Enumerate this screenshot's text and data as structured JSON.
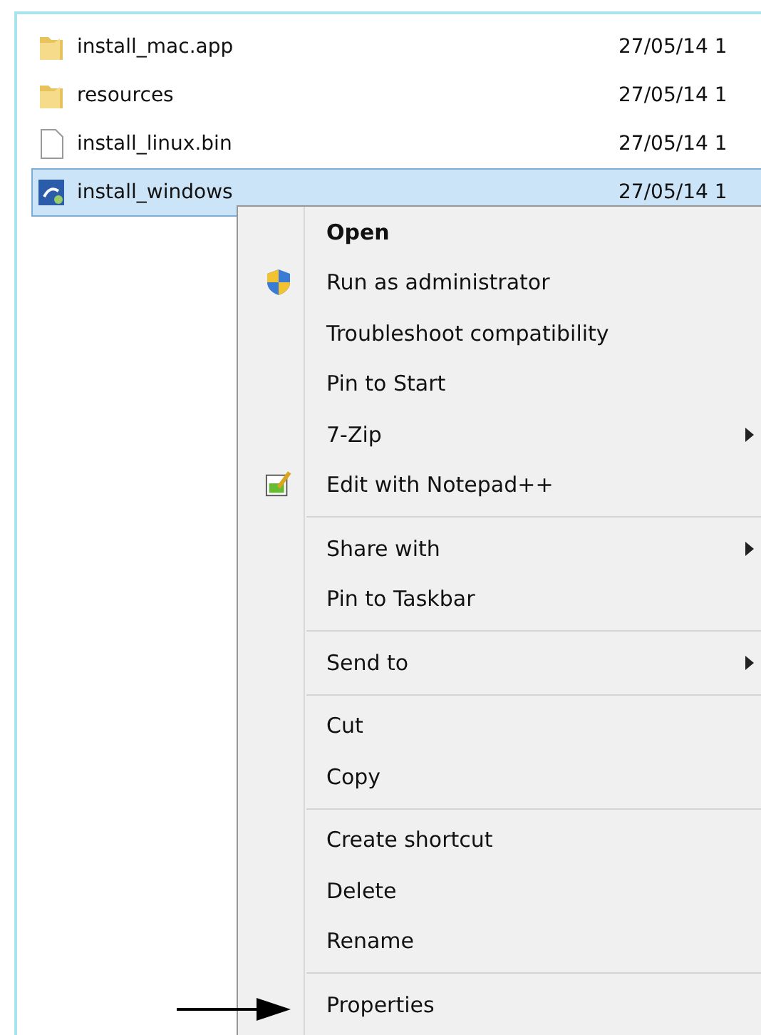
{
  "files": [
    {
      "name": "install_mac.app",
      "date": "27/05/14 1",
      "kind": "folder",
      "selected": false
    },
    {
      "name": "resources",
      "date": "27/05/14 1",
      "kind": "folder",
      "selected": false
    },
    {
      "name": "install_linux.bin",
      "date": "27/05/14 1",
      "kind": "file",
      "selected": false
    },
    {
      "name": "install_windows",
      "date": "27/05/14 1",
      "kind": "installer",
      "selected": true
    }
  ],
  "context_menu": {
    "items": [
      {
        "kind": "item",
        "label": "Open",
        "default": true
      },
      {
        "kind": "shield_item",
        "label": "Run as administrator"
      },
      {
        "kind": "item",
        "label": "Troubleshoot compatibility"
      },
      {
        "kind": "item",
        "label": "Pin to Start"
      },
      {
        "kind": "submenu_item",
        "label": "7-Zip"
      },
      {
        "kind": "notepad_item",
        "label": "Edit with Notepad++"
      },
      {
        "kind": "separator"
      },
      {
        "kind": "submenu_item",
        "label": "Share with"
      },
      {
        "kind": "item",
        "label": "Pin to Taskbar"
      },
      {
        "kind": "separator"
      },
      {
        "kind": "submenu_item",
        "label": "Send to"
      },
      {
        "kind": "separator"
      },
      {
        "kind": "item",
        "label": "Cut"
      },
      {
        "kind": "item",
        "label": "Copy"
      },
      {
        "kind": "separator"
      },
      {
        "kind": "item",
        "label": "Create shortcut"
      },
      {
        "kind": "item",
        "label": "Delete"
      },
      {
        "kind": "item",
        "label": "Rename"
      },
      {
        "kind": "separator"
      },
      {
        "kind": "item",
        "label": "Properties",
        "pointed": true
      }
    ]
  }
}
